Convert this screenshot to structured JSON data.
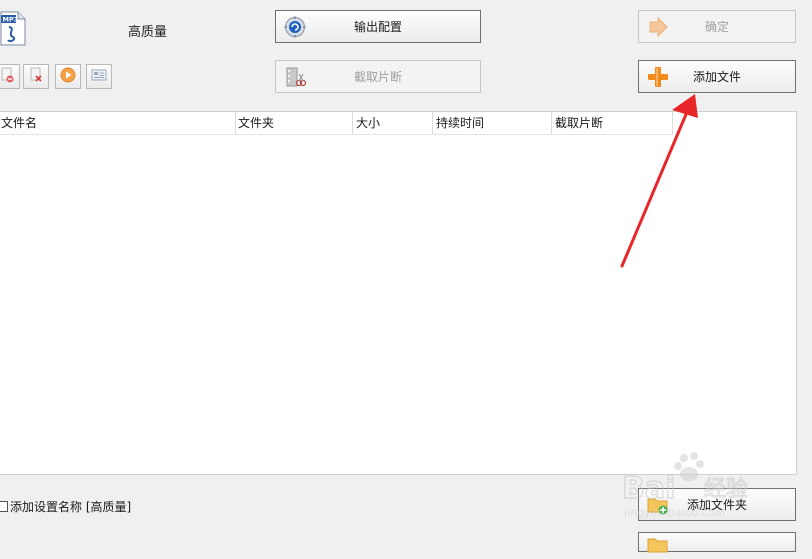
{
  "format": {
    "icon": "mp3-file-icon",
    "quality_label": "高质量"
  },
  "buttons": {
    "output_config": "输出配置",
    "cut_segment": "截取片断",
    "confirm": "确定",
    "add_file": "添加文件",
    "add_folder": "添加文件夹"
  },
  "toolbar": {
    "icons": [
      "remove-icon",
      "clear-icon",
      "play-icon",
      "info-icon"
    ]
  },
  "file_list": {
    "columns": [
      "文件名",
      "文件夹",
      "大小",
      "持续时间",
      "截取片断"
    ],
    "rows": []
  },
  "options": {
    "add_setting_name_label": "添加设置名称 [高质量]",
    "add_setting_name_checked": false
  },
  "annotation": {
    "arrow_color": "#e8262a"
  },
  "watermark": {
    "text": "Bai 经验"
  },
  "colors": {
    "accent_orange": "#f28b1e",
    "config_blue": "#1f5fbf",
    "disabled_text": "#a0a0a0"
  }
}
